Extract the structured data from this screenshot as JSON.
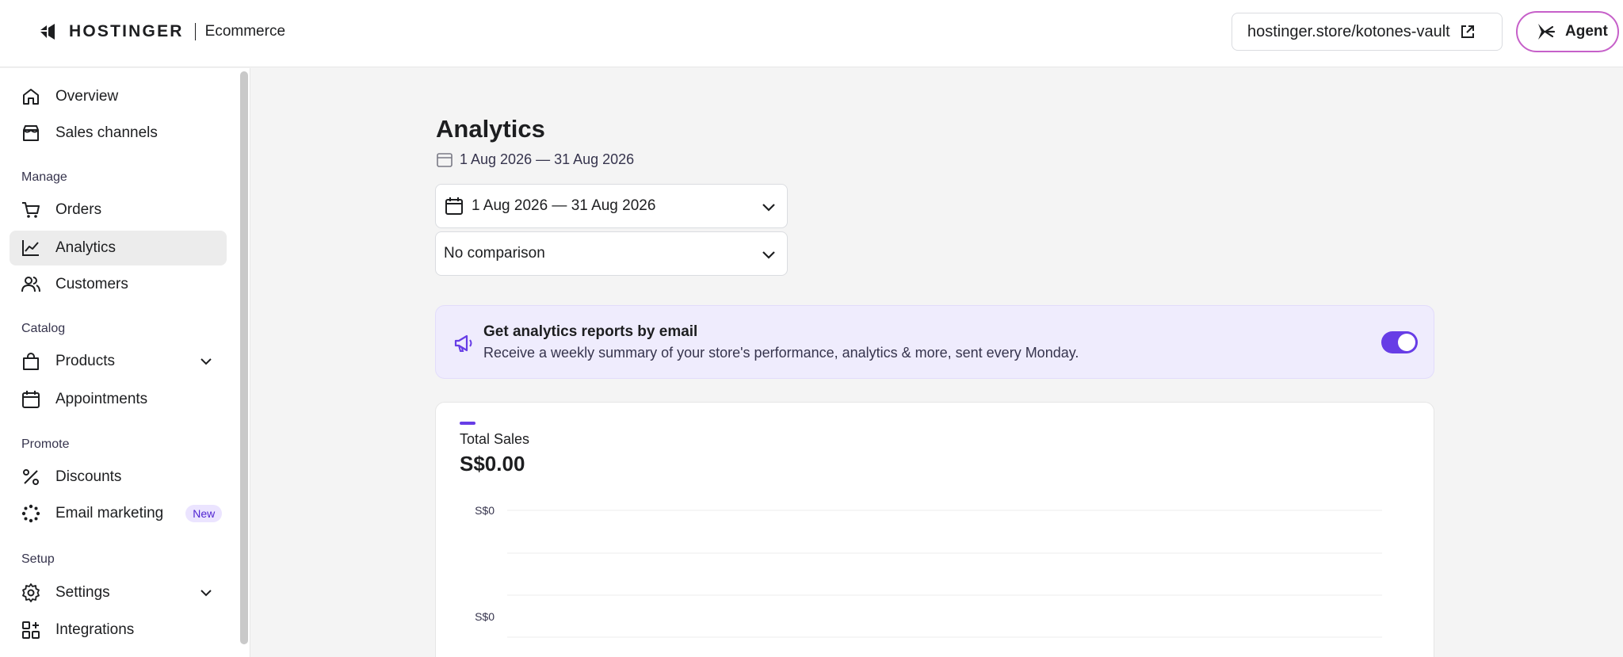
{
  "header": {
    "brand": "HOSTINGER",
    "product": "Ecommerce",
    "store_url": "hostinger.store/kotones-vault",
    "agent_label": "Agent"
  },
  "sidebar": {
    "items_top": [
      {
        "label": "Overview",
        "icon": "home-icon"
      },
      {
        "label": "Sales channels",
        "icon": "store-icon"
      }
    ],
    "manage_label": "Manage",
    "manage": [
      {
        "label": "Orders",
        "icon": "cart-icon"
      },
      {
        "label": "Analytics",
        "icon": "chart-icon",
        "active": true
      },
      {
        "label": "Customers",
        "icon": "users-icon"
      }
    ],
    "catalog_label": "Catalog",
    "catalog": [
      {
        "label": "Products",
        "icon": "bag-icon"
      },
      {
        "label": "Appointments",
        "icon": "calendar-icon"
      }
    ],
    "promote_label": "Promote",
    "promote": [
      {
        "label": "Discounts",
        "icon": "percent-icon"
      },
      {
        "label": "Email marketing",
        "icon": "sparkle-icon",
        "badge": "New"
      }
    ],
    "setup_label": "Setup",
    "setup": [
      {
        "label": "Settings",
        "icon": "gear-icon"
      },
      {
        "label": "Integrations",
        "icon": "grid-plus-icon"
      }
    ]
  },
  "main": {
    "title": "Analytics",
    "date_range": "1 Aug 2026 — 31 Aug 2026",
    "date_select": "1 Aug 2026 — 31 Aug 2026",
    "comparison_select": "No comparison",
    "banner": {
      "title": "Get analytics reports by email",
      "text": "Receive a weekly summary of your store's performance, analytics & more, sent every Monday.",
      "toggle_on": true
    },
    "card": {
      "label": "Total Sales",
      "value": "S$0.00"
    }
  },
  "colors": {
    "accent": "#673de6",
    "banner_bg": "#efecfd",
    "badge_bg": "#ebe4ff"
  },
  "chart_data": {
    "type": "line",
    "title": "",
    "xlabel": "",
    "ylabel": "",
    "y_ticks": [
      "S$0",
      "S$0"
    ],
    "series": [
      {
        "values": []
      }
    ],
    "grid": true
  }
}
